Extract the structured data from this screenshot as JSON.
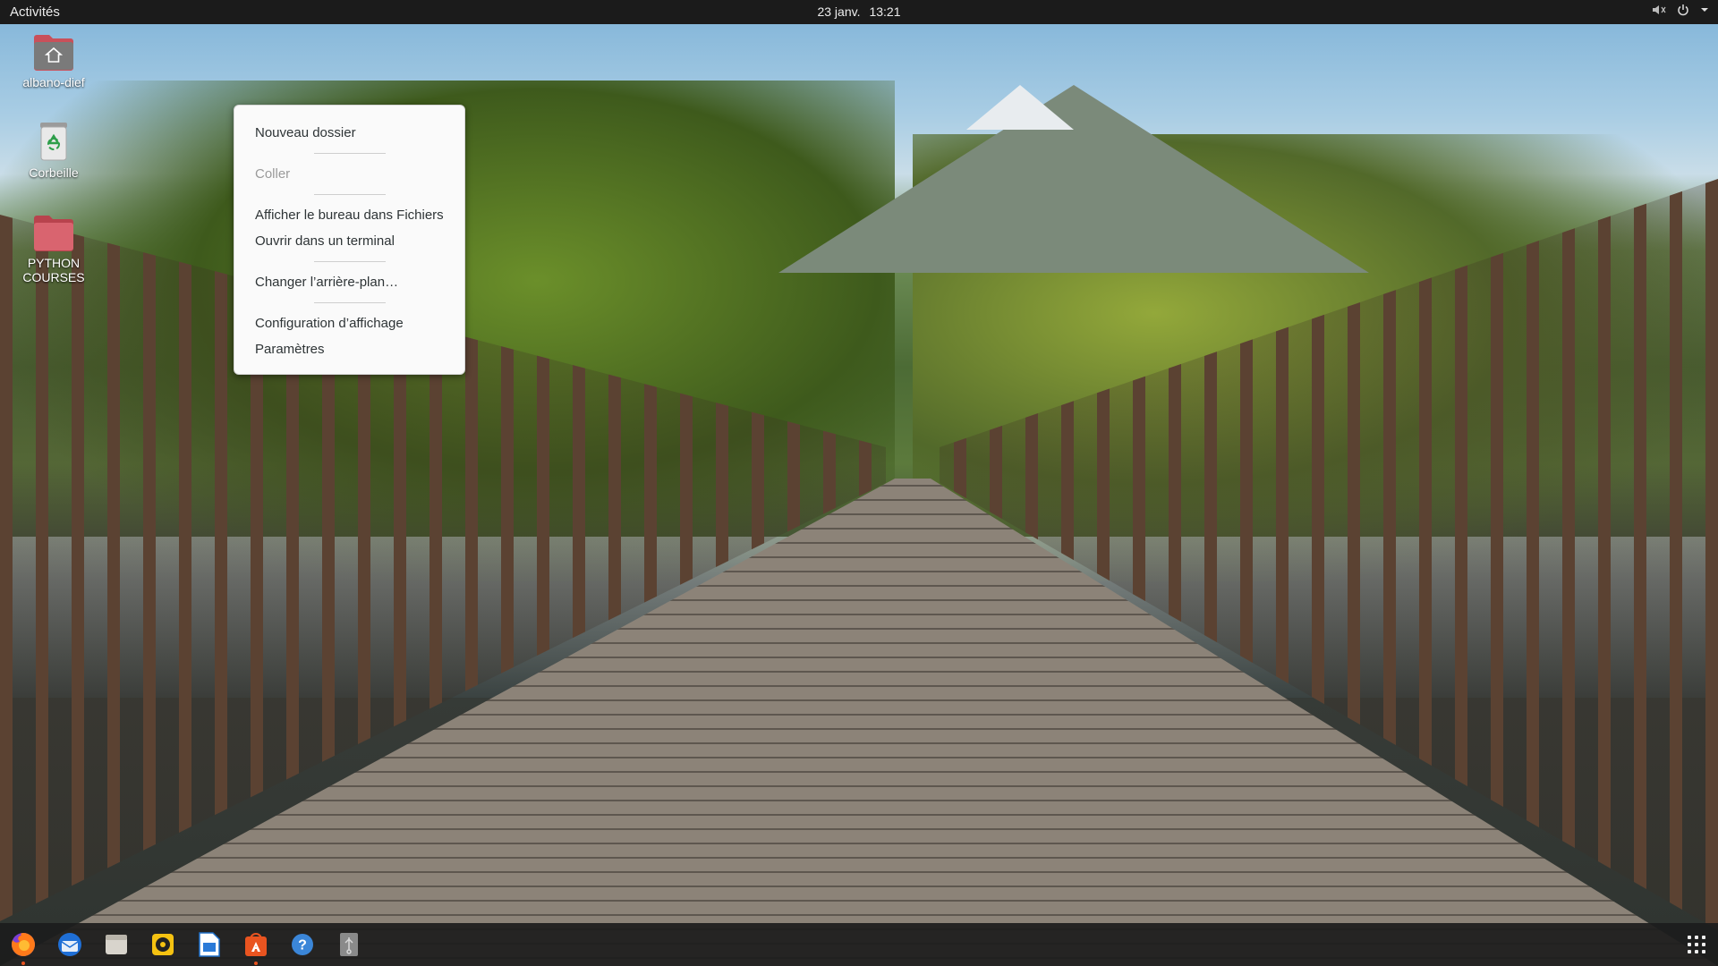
{
  "topbar": {
    "activities": "Activités",
    "date": "23 janv.",
    "time": "13:21",
    "tray_icons": [
      "speaker-muted-icon",
      "power-icon",
      "chevron-down-icon"
    ]
  },
  "desktop_icons": [
    {
      "label": "albano-dief",
      "icon": "home-folder-icon"
    },
    {
      "label": "Corbeille",
      "icon": "trash-icon"
    },
    {
      "label": "PYTHON COURSES",
      "icon": "folder-icon"
    }
  ],
  "context_menu": {
    "items": {
      "new_folder": "Nouveau dossier",
      "paste": "Coller",
      "show_in_files": "Afficher le bureau dans Fichiers",
      "open_terminal": "Ouvrir dans un terminal",
      "change_background": "Changer l’arrière-plan…",
      "display_settings": "Configuration d’affichage",
      "settings": "Paramètres"
    }
  },
  "dock": {
    "apps": [
      {
        "name": "Firefox",
        "icon": "firefox-icon",
        "running": true
      },
      {
        "name": "Thunderbird",
        "icon": "thunderbird-icon",
        "running": false
      },
      {
        "name": "Fichiers",
        "icon": "files-icon",
        "running": false
      },
      {
        "name": "Rhythmbox",
        "icon": "rhythmbox-icon",
        "running": false
      },
      {
        "name": "LibreOffice Writer",
        "icon": "writer-icon",
        "running": false
      },
      {
        "name": "Ubuntu Software",
        "icon": "software-store-icon",
        "running": true
      },
      {
        "name": "Aide",
        "icon": "help-icon",
        "running": false
      },
      {
        "name": "USB",
        "icon": "usb-drive-icon",
        "running": false
      }
    ],
    "show_apps_icon": "app-grid-icon"
  },
  "colors": {
    "accent": "#e95420",
    "topbar": "#1b1b1b",
    "menu_bg": "#fafafa"
  }
}
